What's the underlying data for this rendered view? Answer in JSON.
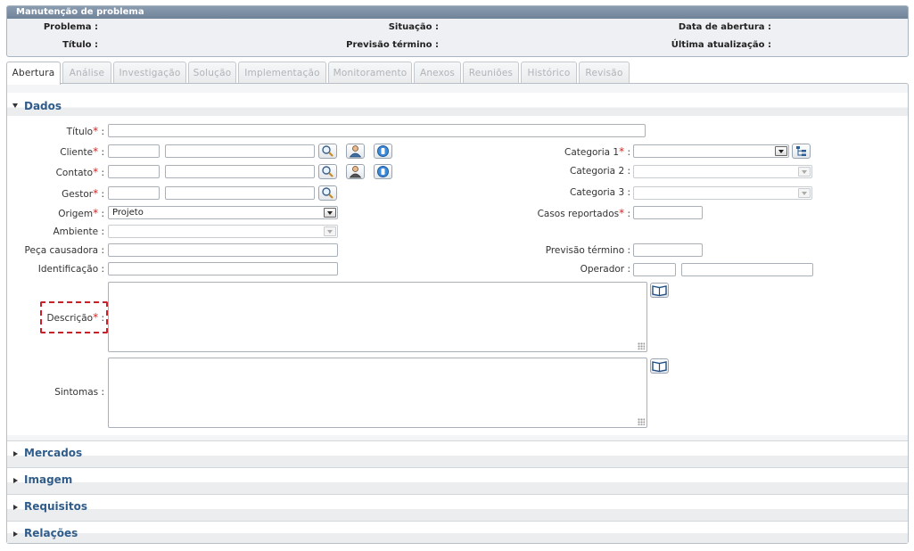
{
  "header": {
    "title": "Manutenção de problema",
    "problema_label": "Problema :",
    "situacao_label": "Situação :",
    "data_abertura_label": "Data de abertura :",
    "titulo_label": "Título :",
    "previsao_label": "Previsão término :",
    "ultima_label": "Última atualização :"
  },
  "tabs": [
    {
      "label": "Abertura",
      "active": true
    },
    {
      "label": "Análise"
    },
    {
      "label": "Investigação"
    },
    {
      "label": "Solução"
    },
    {
      "label": "Implementação"
    },
    {
      "label": "Monitoramento"
    },
    {
      "label": "Anexos"
    },
    {
      "label": "Reuniões"
    },
    {
      "label": "Histórico"
    },
    {
      "label": "Revisão"
    }
  ],
  "sections": {
    "dados": "Dados",
    "mercados": "Mercados",
    "imagem": "Imagem",
    "requisitos": "Requisitos",
    "relacoes": "Relações"
  },
  "form": {
    "titulo": "Título",
    "cliente": "Cliente",
    "contato": "Contato",
    "gestor": "Gestor",
    "origem": "Origem",
    "origem_value": "Projeto",
    "ambiente": "Ambiente :",
    "peca": "Peça causadora :",
    "identificacao": "Identificação :",
    "descricao": "Descrição",
    "sintomas": "Sintomas :",
    "categoria1": "Categoria 1",
    "categoria2": "Categoria 2 :",
    "categoria3": "Categoria 3 :",
    "casos": "Casos reportados",
    "previsao": "Previsão término :",
    "operador": "Operador :",
    "required_mark": "*",
    "colon": " :"
  },
  "icons": {
    "search": "search-icon",
    "user": "user-icon",
    "info": "info-icon",
    "tree": "tree-icon",
    "book": "book-icon"
  },
  "colors": {
    "header_bar": "#7a8da2",
    "section_title": "#2f5c8a",
    "required": "#dd2222",
    "focus_border": "#c9202a"
  }
}
